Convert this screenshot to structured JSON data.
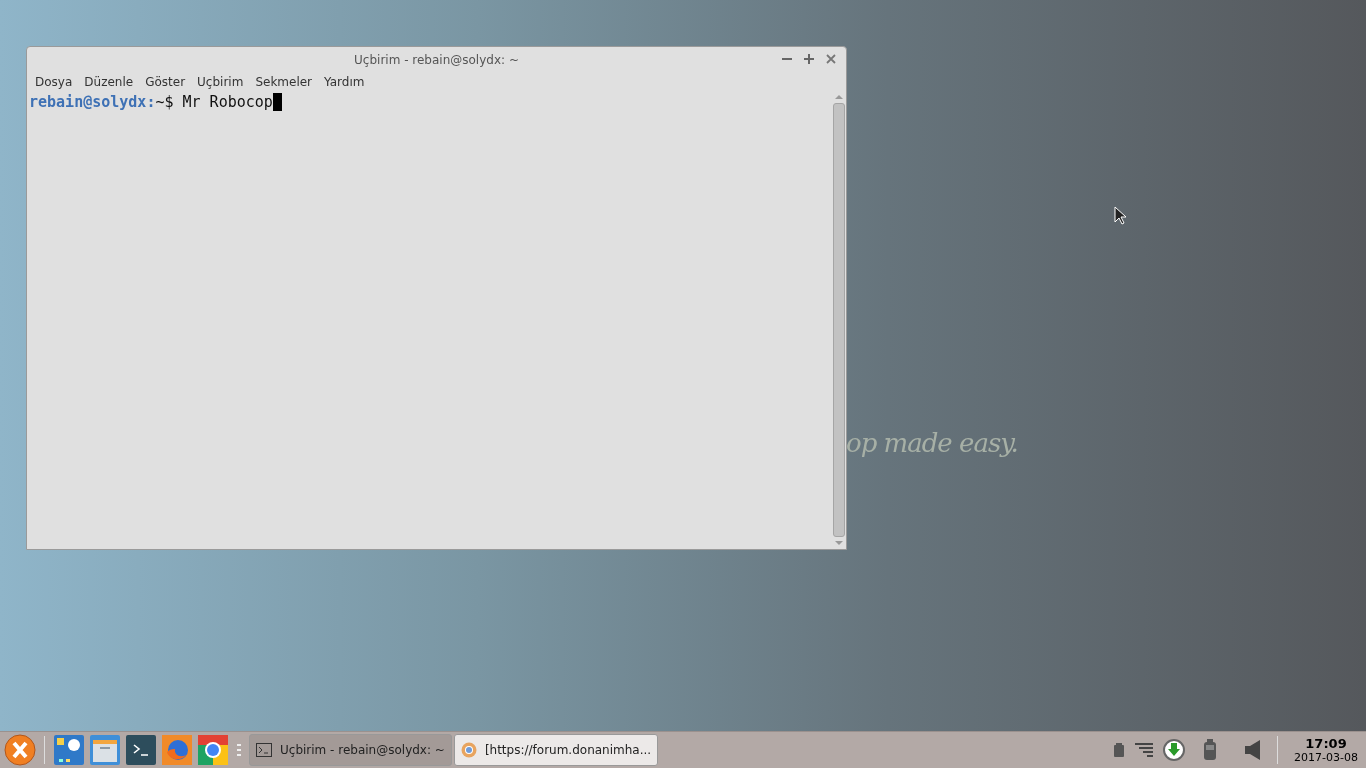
{
  "wallpaper": {
    "tagline": "op made easy."
  },
  "window": {
    "title": "Uçbirim - rebain@solydx: ~",
    "menu": [
      "Dosya",
      "Düzenle",
      "Göster",
      "Uçbirim",
      "Sekmeler",
      "Yardım"
    ],
    "terminal": {
      "user_host": "rebain@solydx",
      "separator": ":",
      "path_prompt": "~$",
      "command": "Mr Robocop"
    }
  },
  "taskbar": {
    "launchers": [
      {
        "kind": "calendar"
      },
      {
        "kind": "files"
      },
      {
        "kind": "terminal"
      },
      {
        "kind": "firefox"
      },
      {
        "kind": "chrome"
      }
    ],
    "tasks": [
      {
        "label": "Uçbirim - rebain@solydx: ~",
        "kind": "terminal",
        "selected": true
      },
      {
        "label": "[https://forum.donanimha...",
        "kind": "browser",
        "selected": false
      }
    ],
    "clock": {
      "time": "17:09",
      "date": "2017-03-08"
    }
  }
}
